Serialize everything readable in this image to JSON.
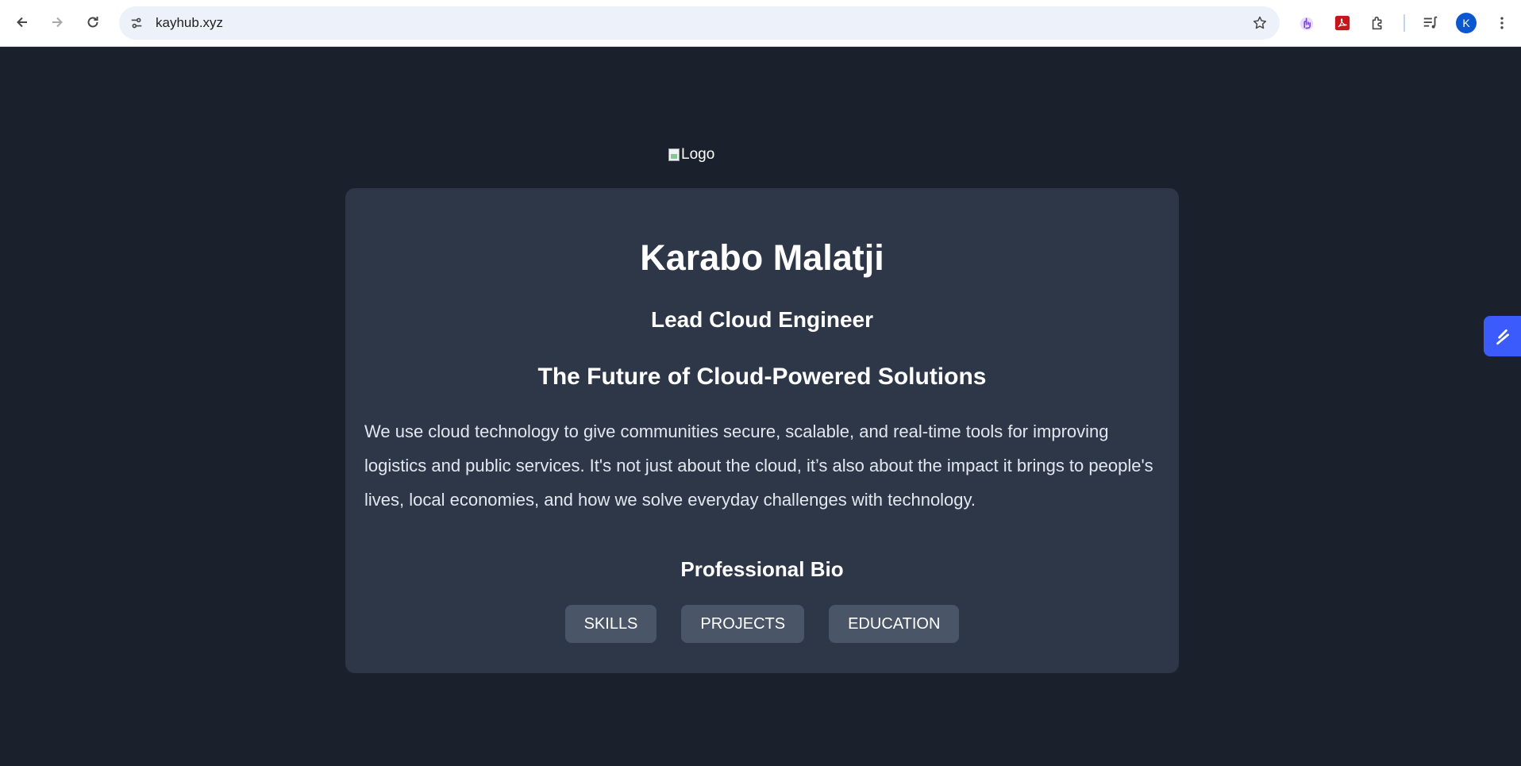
{
  "browser": {
    "url": "kayhub.xyz",
    "avatar_initial": "K"
  },
  "page": {
    "logo_alt": "Logo",
    "name": "Karabo Malatji",
    "role": "Lead Cloud Engineer",
    "tagline": "The Future of Cloud-Powered Solutions",
    "description": "We use cloud technology to give communities secure, scalable, and real-time tools for improving logistics and public services. It's not just about the cloud, it’s also about the impact it brings to people's lives, local economies, and how we solve everyday challenges with technology.",
    "bio_heading": "Professional Bio",
    "buttons": {
      "skills": "SKILLS",
      "projects": "PROJECTS",
      "education": "EDUCATION"
    }
  },
  "colors": {
    "background": "#1a202c",
    "card": "#2d3748",
    "button": "#4a5568",
    "side_tab": "#3b5bfd"
  }
}
